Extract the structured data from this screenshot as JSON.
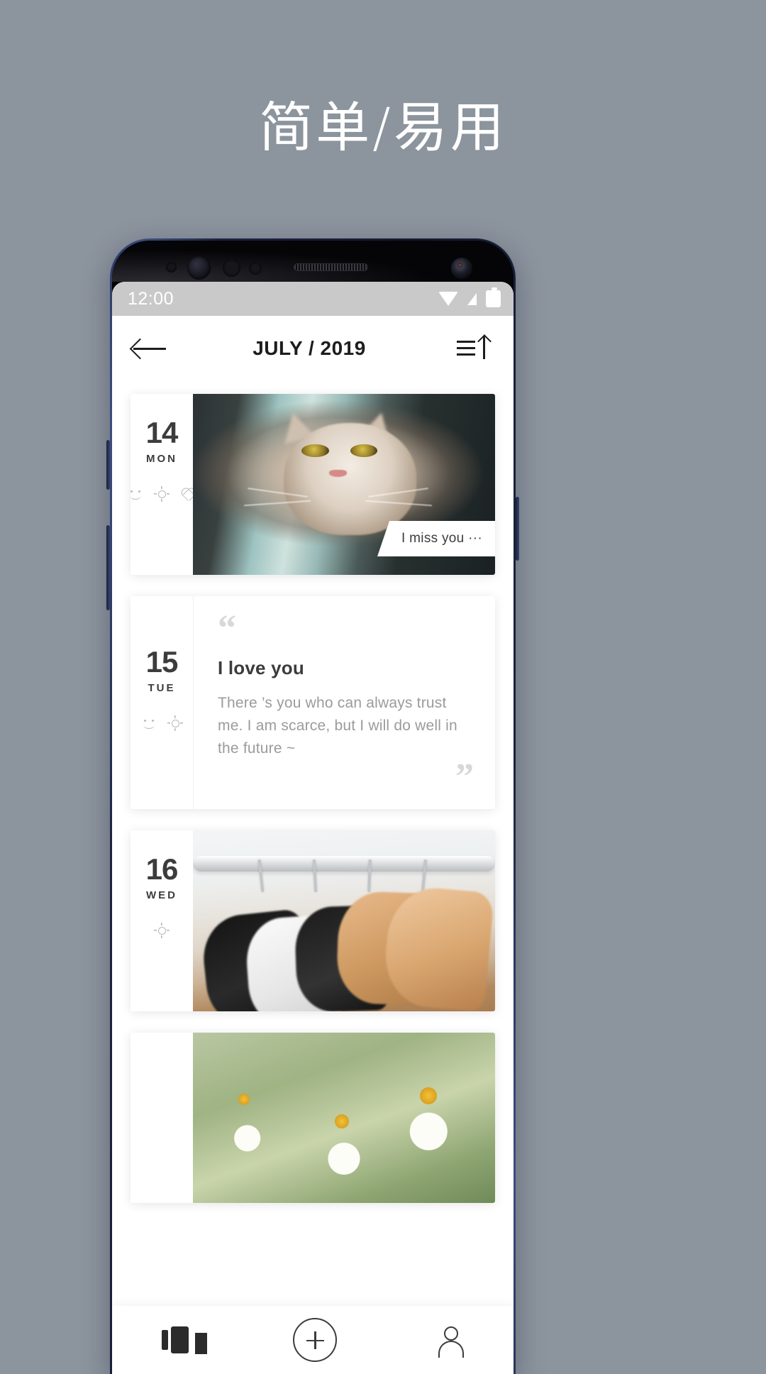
{
  "headline": "简单/易用",
  "status_bar": {
    "time": "12:00",
    "icons": [
      "wifi-icon",
      "signal-icon",
      "battery-icon"
    ]
  },
  "app_bar": {
    "back_icon": "back-arrow-icon",
    "title": "JULY / 2019",
    "sort_icon": "sort-ascending-icon"
  },
  "entries": [
    {
      "day": "14",
      "weekday": "MON",
      "tags": [
        "smiley-icon",
        "sun-icon",
        "heart-icon"
      ],
      "type": "photo",
      "photo": "cat-photo",
      "caption": "I miss you ···"
    },
    {
      "day": "15",
      "weekday": "TUE",
      "tags": [
        "smiley-icon",
        "sun-icon"
      ],
      "type": "quote",
      "quote_open": "“",
      "quote_close": "”",
      "title": "I love you",
      "text": "There ’s you who can always trust me. I am scarce, but I will do well in the future ~"
    },
    {
      "day": "16",
      "weekday": "WED",
      "tags": [
        "sun-icon"
      ],
      "type": "photo",
      "photo": "clothes-hangers-photo"
    },
    {
      "day": "",
      "weekday": "",
      "tags": [],
      "type": "photo",
      "photo": "daisy-flowers-photo"
    }
  ],
  "bottom_nav": [
    {
      "icon": "cards-stack-icon",
      "label": ""
    },
    {
      "icon": "plus-circle-icon",
      "label": ""
    },
    {
      "icon": "user-profile-icon",
      "label": ""
    }
  ],
  "colors": {
    "page_background": "#8c949e",
    "card_background": "#ffffff",
    "text_primary": "#3c3c3c",
    "text_secondary": "#9b9b9b",
    "tag_icon": "#b9b9b9",
    "status_bar": "#c9c9c9",
    "phone_frame": "#1b2340"
  }
}
